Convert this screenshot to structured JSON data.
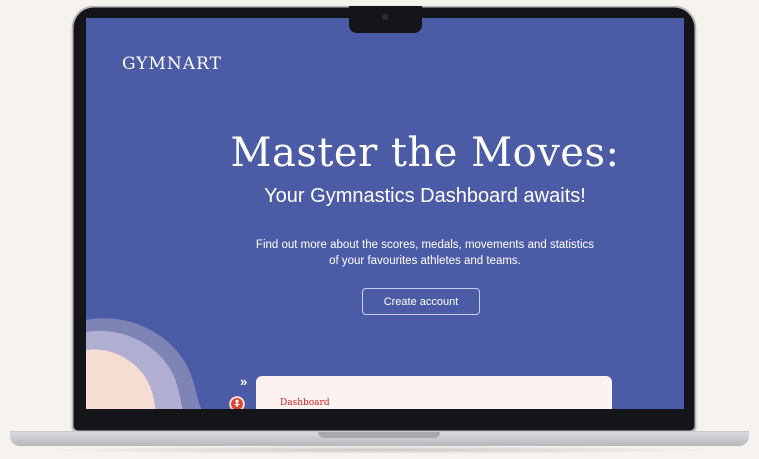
{
  "brand": {
    "name": "GYMNART"
  },
  "hero": {
    "title": "Master the Moves:",
    "subtitle": "Your Gymnastics Dashboard awaits!",
    "description_line1": "Find out more about the scores, medals, movements and statistics",
    "description_line2": "of your favourites athletes and teams.",
    "cta_label": "Create account"
  },
  "preview": {
    "expand_icon": "chevrons-right-icon",
    "avatar_icon": "gymnast-icon",
    "dashboard_label": "Dashboard"
  },
  "colors": {
    "screen_background": "#4c5ba6",
    "card_background": "#fdf2ef",
    "dashboard_label": "#c8252a",
    "page_background": "#f6f3ef"
  }
}
